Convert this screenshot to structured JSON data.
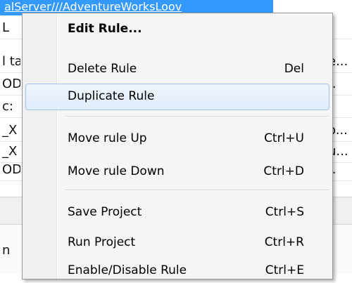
{
  "background": {
    "title_fragment": "alServer///AdventureWorksLoov",
    "rows": [
      {
        "left": "L",
        "right": ""
      },
      {
        "left": "l ta",
        "right": "e..."
      },
      {
        "left": "OD",
        "right": ".."
      },
      {
        "left": "c:",
        "right": ""
      },
      {
        "left": "_X",
        "right": "o..."
      },
      {
        "left": "_X",
        "right": "u..."
      },
      {
        "left": "OD",
        "right": ".."
      }
    ],
    "bottom_left": "n"
  },
  "menu": {
    "items": [
      {
        "label": "Edit Rule...",
        "shortcut": ""
      },
      {
        "label": "Delete Rule",
        "shortcut": "Del"
      },
      {
        "label": "Duplicate Rule",
        "shortcut": ""
      },
      {
        "label": "Move rule Up",
        "shortcut": "Ctrl+U"
      },
      {
        "label": "Move rule Down",
        "shortcut": "Ctrl+D"
      },
      {
        "label": "Save Project",
        "shortcut": "Ctrl+S"
      },
      {
        "label": "Run Project",
        "shortcut": "Ctrl+R"
      },
      {
        "label": "Enable/Disable Rule",
        "shortcut": "Ctrl+E"
      }
    ],
    "highlighted_item": "Duplicate Rule"
  }
}
